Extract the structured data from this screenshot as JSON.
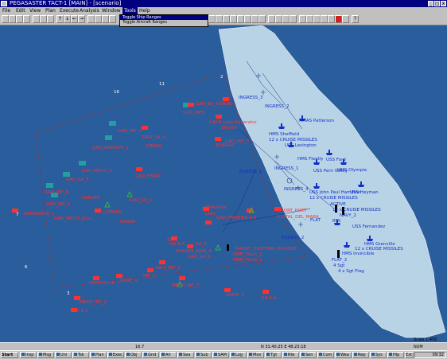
{
  "window": {
    "title": "PEGASASTER TACT-1 [MAIN] - [scenario]",
    "buttons": [
      "_",
      "□",
      "x"
    ]
  },
  "menu": {
    "items": [
      "File",
      "Edit",
      "View",
      "Plan",
      "Execute",
      "Analysis",
      "Window",
      "Tools",
      "Help"
    ],
    "active": "Tools"
  },
  "dropdown": {
    "items": [
      "Toggle Ship Ranges",
      "Toggle Aircraft Ranges"
    ]
  },
  "map": {
    "colors": {
      "sea": "#2a5d9b",
      "land": "#b9d3e6",
      "hostile": "#ff3030",
      "friendly": "#1030c8",
      "neutral": "#ffffff"
    },
    "grid_numbers": [
      "16",
      "11",
      "2",
      "7",
      "6",
      "3"
    ],
    "red_units": [
      "DADO",
      "CACA Logo Generator",
      "SHUSH",
      "BANDAR",
      "GAD_BA_3",
      "GAD_INFS",
      "GAD_INF_3",
      "GAD_INF_2",
      "GAD_ARMOUR_1",
      "GAD_SA_4",
      "SPRING",
      "GAD_MECH_2",
      "GAD_FERRY",
      "GAD_SA_5",
      "GAD_INF_6",
      "GAD_INF_1",
      "USRUTU",
      "RAMADOUR_1",
      "GAD_MECH_2(hc)",
      "LSPRING",
      "NASAR",
      "GAD_SA_1",
      "KHAVKAN",
      "LAKI",
      "GAD_FRONT",
      "SA-2-3",
      "SA-3-4",
      "EGORT_PORT",
      "COSTAL_DEL_MABA",
      "SA-4",
      "KORREA_ARIR_4",
      "GAD_SA_6",
      "SA_3",
      "SA-3_INF_3",
      "TARGET_EASTERN_PROMISE",
      "EMPI_Truck_1",
      "EMPI_Truck_2",
      "RAMADOUR_1",
      "SNIRE_V",
      "INF_1",
      "MECH_INF_3",
      "RAPID_1",
      "SA-3-4",
      "MECH_INF_2",
      "SA-3-3"
    ],
    "blue_units": [
      "INGRESS_3",
      "INGRESS_2",
      "HMAS Patterson",
      "HMS Sheffield",
      "12 x CRUISE MISSILES",
      "USS Lexington",
      "HMS Fleetly",
      "USS Ford",
      "USS Pern Valley",
      "HMS Olympia",
      "EGRESS_1",
      "INGRESS_1",
      "INGRESS_4",
      "USS John Paul Hamilton",
      "12 x CRUISE MISSILES",
      "USS Heyman",
      "12 x CRUISE MISSILES",
      "ACTIVE",
      "NAVY_2",
      "FLAT",
      "RTS",
      "USS Fernandez",
      "EGRESS_2",
      "HMS Invincible",
      "12 x CRUISE MISSILES",
      "HMS Grenville",
      "FLAT_2",
      "4 Sgt",
      "4 x Sgt Flag"
    ],
    "scale": "Scale 1:450"
  },
  "status": {
    "left": "16.7",
    "center": "N 31:40:25 E 48:23:18",
    "right": "NUM"
  },
  "taskbar": {
    "items": [
      "Start",
      "Insp",
      "Msg",
      "Uni",
      "Tsk",
      "Plan",
      "Exec",
      "Obj",
      "Gnd",
      "Air",
      "Sea",
      "Sub",
      "SAM",
      "Log",
      "Mov",
      "Tgt",
      "Rte",
      "Sen",
      "Com",
      "Wea",
      "Rep",
      "Sys",
      "Hlp",
      "Ext"
    ],
    "clock": "09:32"
  }
}
